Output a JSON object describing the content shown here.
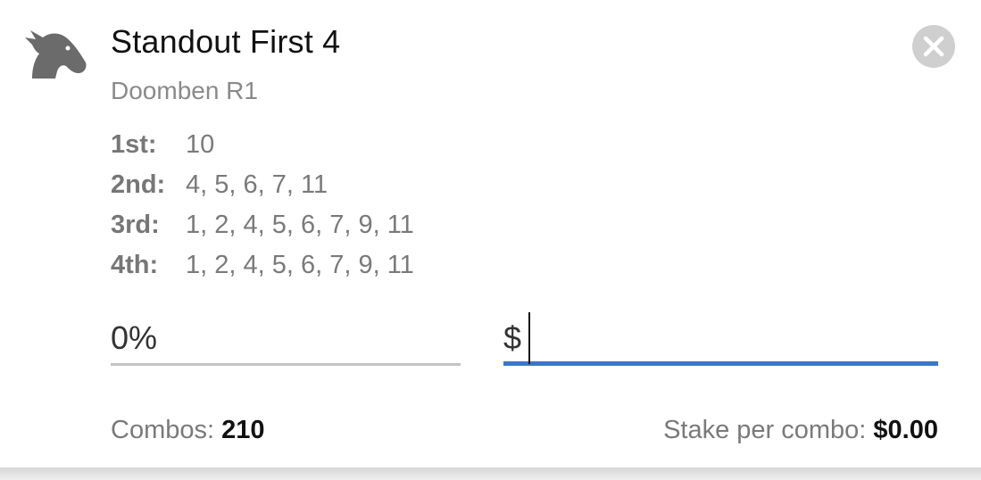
{
  "bet": {
    "title": "Standout First 4",
    "race": "Doomben R1",
    "icon": "horse-head-icon"
  },
  "legs": [
    {
      "label": "1st:",
      "value": "10"
    },
    {
      "label": "2nd:",
      "value": "4, 5, 6, 7, 11"
    },
    {
      "label": "3rd:",
      "value": "1, 2, 4, 5, 6, 7, 9, 11"
    },
    {
      "label": "4th:",
      "value": "1, 2, 4, 5, 6, 7, 9, 11"
    }
  ],
  "inputs": {
    "percent_value": "0%",
    "stake_prefix": "$",
    "stake_value": ""
  },
  "footer": {
    "combos_label": "Combos: ",
    "combos_value": "210",
    "stake_per_combo_label": "Stake per combo: ",
    "stake_per_combo_value": "$0.00"
  },
  "colors": {
    "active_underline": "#3b78c4",
    "inactive_underline": "#c4c4c4",
    "close_button": "#cfcfcf"
  }
}
